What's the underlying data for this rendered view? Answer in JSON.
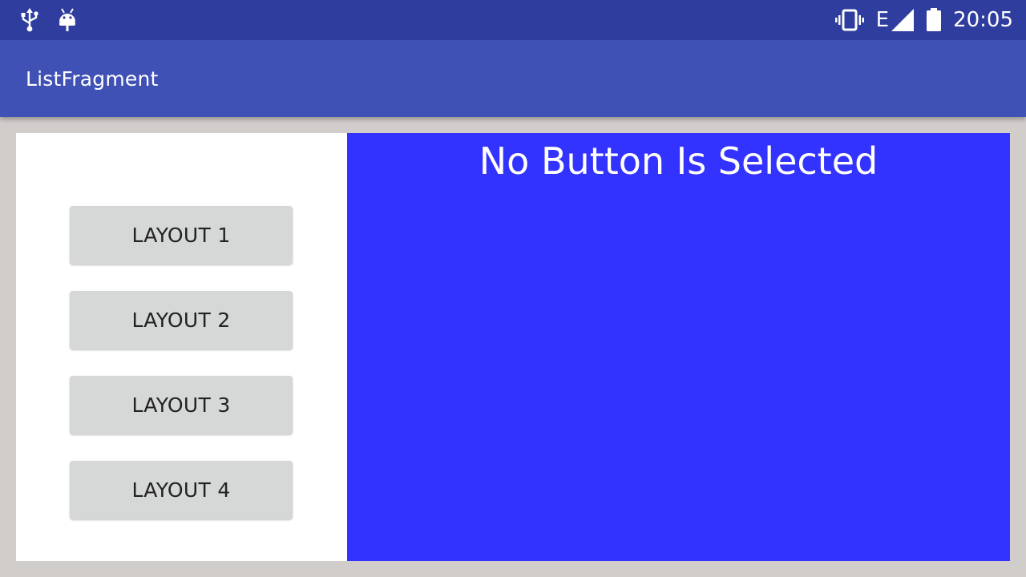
{
  "status_bar": {
    "left_icons": [
      "usb-icon",
      "android-debug-icon"
    ],
    "right_icons": [
      "vibrate-icon",
      "signal-e-icon",
      "battery-icon"
    ],
    "network_label": "E",
    "time": "20:05",
    "color": "#2f3e9e"
  },
  "app_bar": {
    "title": "ListFragment",
    "color": "#3f51b5"
  },
  "left_panel": {
    "buttons": [
      {
        "label": "LAYOUT 1"
      },
      {
        "label": "LAYOUT 2"
      },
      {
        "label": "LAYOUT 3"
      },
      {
        "label": "LAYOUT 4"
      }
    ]
  },
  "right_panel": {
    "heading": "No Button Is Selected",
    "color": "#3333ff"
  }
}
